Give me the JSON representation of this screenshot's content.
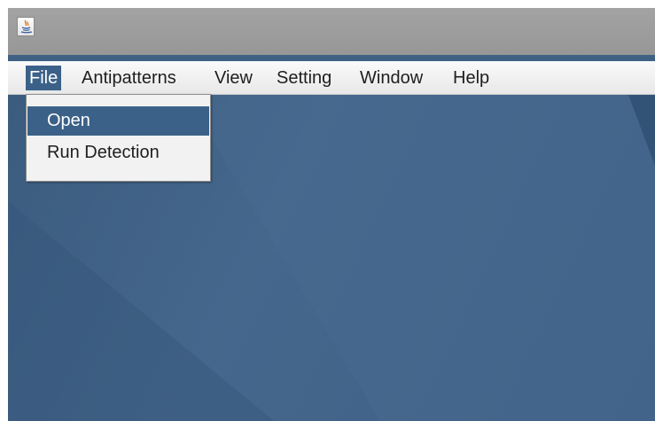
{
  "window": {
    "icon": "java-icon"
  },
  "menu": {
    "items": [
      {
        "label": "File",
        "active": true
      },
      {
        "label": "Antipatterns"
      },
      {
        "label": "View"
      },
      {
        "label": "Setting"
      },
      {
        "label": "Window"
      },
      {
        "label": "Help"
      }
    ]
  },
  "file_menu": {
    "items": [
      {
        "label": "Open",
        "highlighted": true
      },
      {
        "label": "Run Detection"
      }
    ]
  },
  "colors": {
    "menu_highlight": "#3b6188",
    "desktop": "#45678c",
    "title_bar": "#a3a3a3"
  }
}
